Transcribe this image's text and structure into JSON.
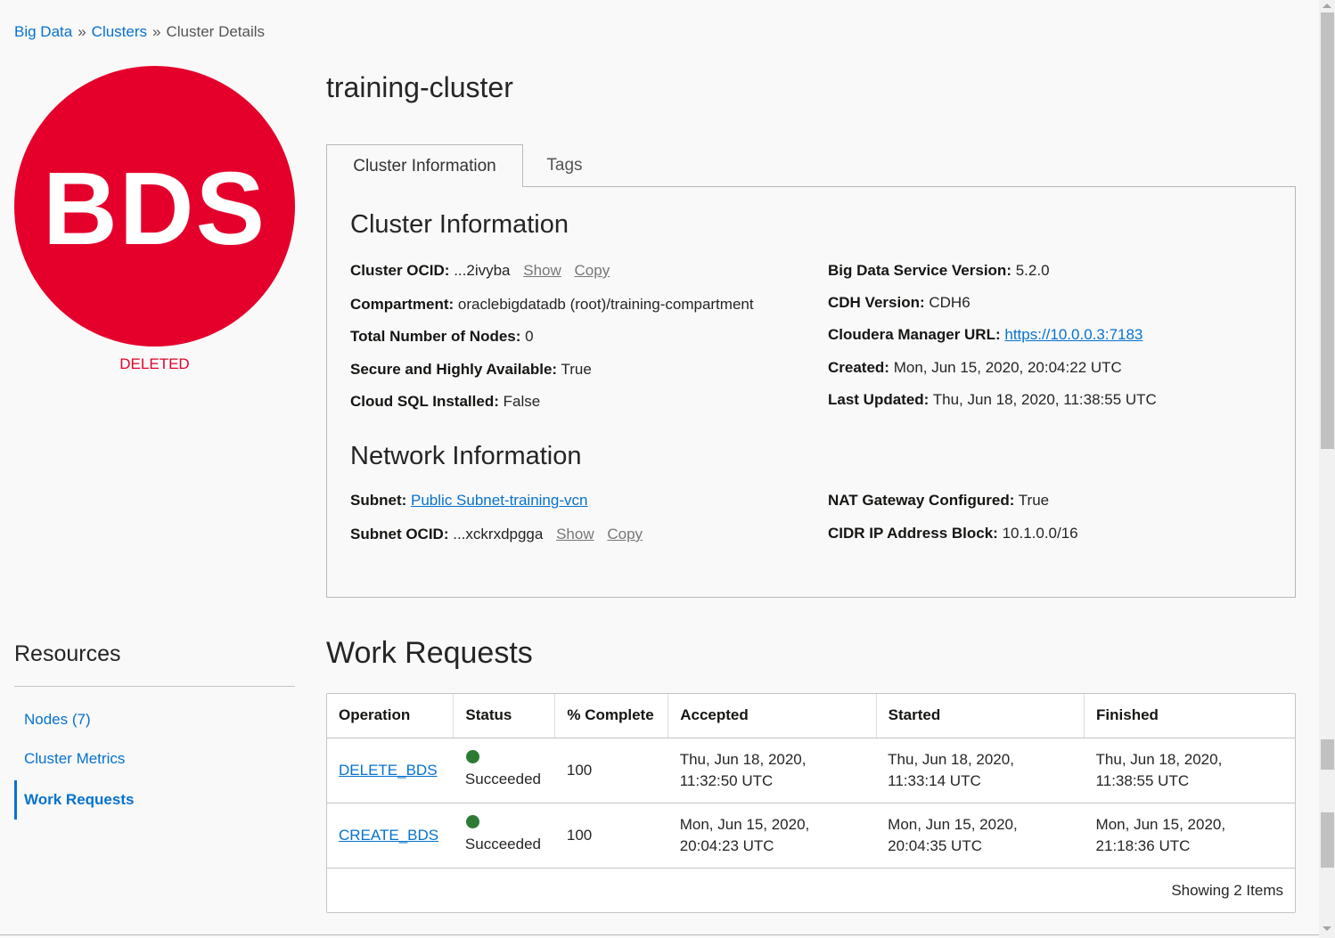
{
  "breadcrumb": {
    "items": [
      "Big Data",
      "Clusters",
      "Cluster Details"
    ],
    "separator": "»"
  },
  "badge": {
    "text": "BDS",
    "lifecycle_state": "DELETED",
    "color": "#e4002b"
  },
  "page_title": "training-cluster",
  "tabs": [
    {
      "label": "Cluster Information",
      "active": true
    },
    {
      "label": "Tags",
      "active": false
    }
  ],
  "cluster_info": {
    "title": "Cluster Information",
    "left": [
      {
        "label": "Cluster OCID:",
        "value": "...2ivyba",
        "show": "Show",
        "copy": "Copy"
      },
      {
        "label": "Compartment:",
        "value": "oraclebigdatadb (root)/training-compartment"
      },
      {
        "label": "Total Number of Nodes:",
        "value": "0"
      },
      {
        "label": "Secure and Highly Available:",
        "value": "True"
      },
      {
        "label": "Cloud SQL Installed:",
        "value": "False"
      }
    ],
    "right": [
      {
        "label": "Big Data Service Version:",
        "value": "5.2.0"
      },
      {
        "label": "CDH Version:",
        "value": "CDH6"
      },
      {
        "label": "Cloudera Manager URL:",
        "value": "https://10.0.0.3:7183"
      },
      {
        "label": "Created:",
        "value": "Mon, Jun 15, 2020, 20:04:22 UTC"
      },
      {
        "label": "Last Updated:",
        "value": "Thu, Jun 18, 2020, 11:38:55 UTC"
      }
    ]
  },
  "network_info": {
    "title": "Network Information",
    "subnet": {
      "label": "Subnet:",
      "value": "Public Subnet-training-vcn"
    },
    "subnet_ocid": {
      "label": "Subnet OCID:",
      "value": "...xckrxdpgga",
      "show": "Show",
      "copy": "Copy"
    },
    "nat": {
      "label": "NAT Gateway Configured:",
      "value": "True"
    },
    "cidr": {
      "label": "CIDR IP Address Block:",
      "value": "10.1.0.0/16"
    }
  },
  "resources": {
    "title": "Resources",
    "items": [
      {
        "label": "Nodes (7)",
        "active": false
      },
      {
        "label": "Cluster Metrics",
        "active": false
      },
      {
        "label": "Work Requests",
        "active": true
      }
    ]
  },
  "work_requests": {
    "title": "Work Requests",
    "columns": [
      "Operation",
      "Status",
      "% Complete",
      "Accepted",
      "Started",
      "Finished"
    ],
    "rows": [
      {
        "operation": "DELETE_BDS",
        "status": "Succeeded",
        "complete": "100",
        "accepted": [
          "Thu, Jun 18, 2020,",
          "11:32:50 UTC"
        ],
        "started": [
          "Thu, Jun 18, 2020,",
          "11:33:14 UTC"
        ],
        "finished": [
          "Thu, Jun 18, 2020,",
          "11:38:55 UTC"
        ]
      },
      {
        "operation": "CREATE_BDS",
        "status": "Succeeded",
        "complete": "100",
        "accepted": [
          "Mon, Jun 15, 2020,",
          "20:04:23 UTC"
        ],
        "started": [
          "Mon, Jun 15, 2020,",
          "20:04:35 UTC"
        ],
        "finished": [
          "Mon, Jun 15, 2020,",
          "21:18:36 UTC"
        ]
      }
    ],
    "footer": "Showing 2 Items"
  }
}
